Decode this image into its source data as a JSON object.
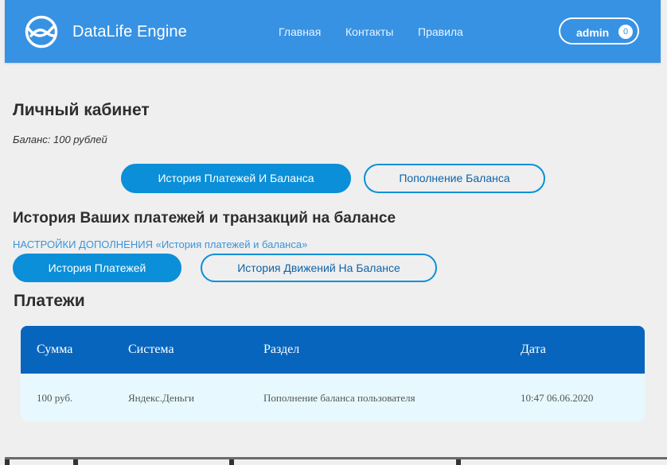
{
  "header": {
    "brand": "DataLife Engine",
    "nav": [
      "Главная",
      "Контакты",
      "Правила"
    ],
    "user": {
      "name": "admin",
      "count": "0"
    }
  },
  "content": {
    "title": "Личный кабинет",
    "balance": "Баланс: 100 рублей",
    "top_tabs": [
      "История Платежей И Баланса",
      "Пополнение Баланса"
    ],
    "history_title": "История Ваших платежей и транзакций на балансе",
    "settings_link": "НАСТРОЙКИ ДОПОЛНЕНИЯ «История платежей и баланса»",
    "sub_tabs": [
      "История Платежей",
      "История Движений На Балансе"
    ],
    "payments_title": "Платежи"
  },
  "table": {
    "headers": [
      "Сумма",
      "Система",
      "Раздел",
      "Дата"
    ],
    "rows": [
      [
        "100 руб.",
        "Яндекс.Деньги",
        "Пополнение баланса пользователя",
        "10:47 06.06.2020"
      ]
    ]
  },
  "colors": {
    "header_bg": "#3792e3",
    "accent": "#0a8fd8",
    "table_header_bg": "#0765bd",
    "table_row_bg": "#e7f9ff"
  }
}
